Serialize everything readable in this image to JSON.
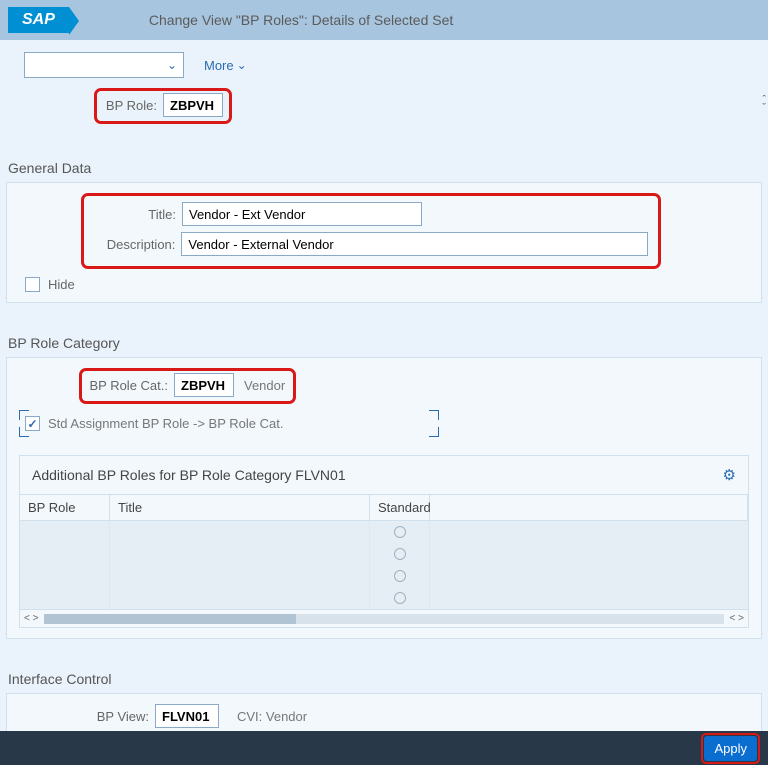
{
  "header": {
    "title": "Change View \"BP Roles\": Details of Selected Set",
    "logo": "SAP"
  },
  "toolbar": {
    "more": "More"
  },
  "bp_role": {
    "label": "BP Role:",
    "value": "ZBPVH"
  },
  "general_data": {
    "section_title": "General Data",
    "title_label": "Title:",
    "title_value": "Vendor - Ext Vendor",
    "desc_label": "Description:",
    "desc_value": "Vendor - External Vendor",
    "hide_label": "Hide"
  },
  "bp_role_category": {
    "section_title": "BP Role Category",
    "cat_label": "BP Role Cat.:",
    "cat_value": "ZBPVH",
    "cat_text": "Vendor",
    "std_assign_label": "Std Assignment BP Role -> BP Role Cat."
  },
  "additional_table": {
    "title": "Additional BP Roles for BP Role Category FLVN01",
    "columns": [
      "BP Role",
      "Title",
      "Standard"
    ]
  },
  "interface_control": {
    "section_title": "Interface Control",
    "bp_view_label": "BP View:",
    "bp_view_value": "FLVN01",
    "cvi_label": "CVI: Vendor"
  },
  "footer": {
    "apply": "Apply"
  }
}
